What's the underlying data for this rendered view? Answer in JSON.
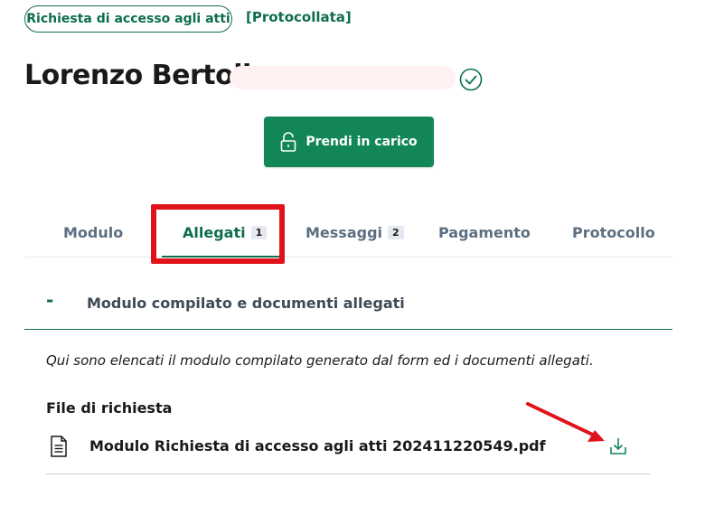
{
  "header": {
    "pill_label": "Richiesta di accesso agli atti",
    "status_text": "[Protocollata]",
    "title": "Lorenzo Bertoli",
    "verified_icon": "check-circle-icon",
    "primary_button_label": "Prendi in carico",
    "primary_button_icon": "lock-open-icon"
  },
  "tabs": [
    {
      "label": "Modulo",
      "count": null
    },
    {
      "label": "Allegati",
      "count": "1"
    },
    {
      "label": "Messaggi",
      "count": "2"
    },
    {
      "label": "Pagamento",
      "count": null
    },
    {
      "label": "Protocollo",
      "count": null
    }
  ],
  "active_tab": "Allegati",
  "accordion": {
    "toggle": "-",
    "title": "Modulo compilato e documenti allegati",
    "description": "Qui sono elencati il modulo compilato generato dal form ed i documenti allegati.",
    "section_label": "File di richiesta",
    "files": [
      {
        "name": "Modulo Richiesta di accesso agli atti 202411220549.pdf",
        "icon": "document-icon",
        "action_icon": "download-icon"
      }
    ]
  },
  "colors": {
    "brand_green": "#128656",
    "dark_green": "#0d6e4e",
    "highlight_red": "#e0121b"
  }
}
